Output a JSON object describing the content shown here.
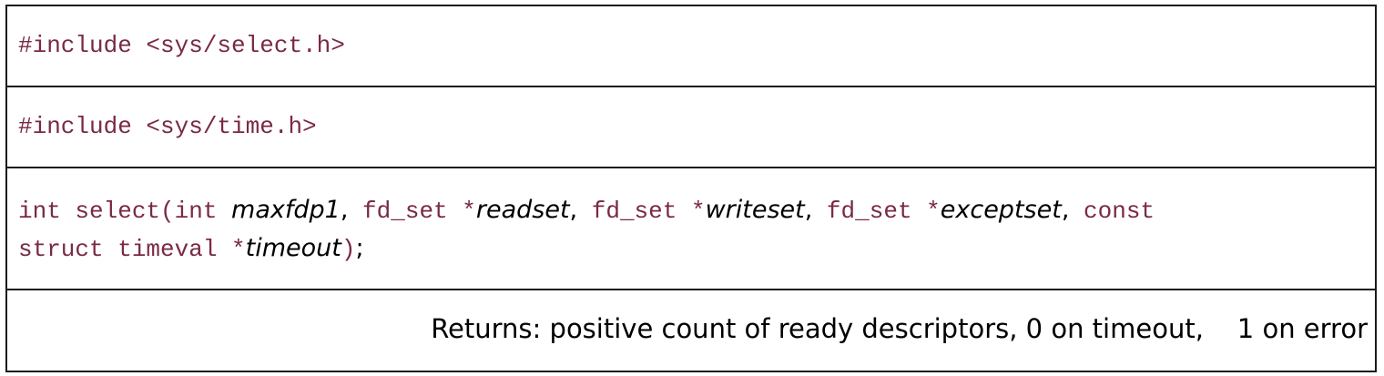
{
  "synopsis": {
    "include_1": "#include <sys/select.h>",
    "include_2": "#include <sys/time.h>",
    "prototype": {
      "line1": {
        "seg_a": "int select(int ",
        "p_maxfdp1": "maxfdp1",
        "c1": ",",
        "seg_b": " fd_set *",
        "p_readset": "readset",
        "c2": ",",
        "seg_c": " fd_set *",
        "p_writeset": "writeset",
        "c3": ",",
        "seg_d": " fd_set *",
        "p_exceptset": "exceptset",
        "c4": ",",
        "seg_e": " const"
      },
      "line2": {
        "seg_a": "struct timeval *",
        "p_timeout": "timeout",
        "seg_b": ")",
        "semicolon": ";"
      }
    },
    "returns": "Returns: positive count of ready descriptors, 0 on timeout,    1 on error"
  }
}
